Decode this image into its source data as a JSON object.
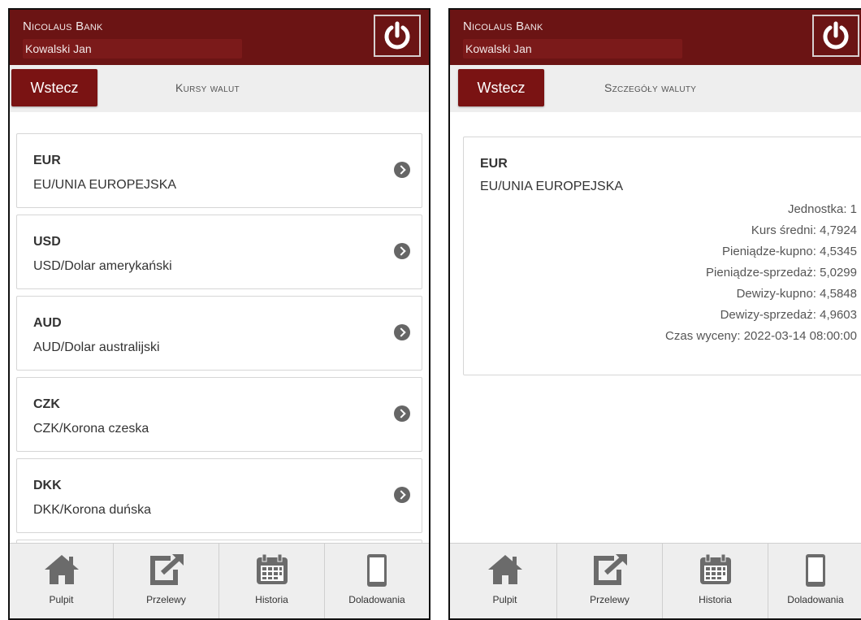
{
  "left": {
    "header": {
      "bank": "Nicolaus Bank",
      "user": "Kowalski Jan"
    },
    "back_label": "Wstecz",
    "title": "Kursy walut",
    "currencies": [
      {
        "code": "EUR",
        "name": "EU/UNIA EUROPEJSKA"
      },
      {
        "code": "USD",
        "name": "USD/Dolar amerykański"
      },
      {
        "code": "AUD",
        "name": "AUD/Dolar australijski"
      },
      {
        "code": "CZK",
        "name": "CZK/Korona czeska"
      },
      {
        "code": "DKK",
        "name": "DKK/Korona duńska"
      }
    ],
    "nav": [
      {
        "label": "Pulpit",
        "icon": "home-icon"
      },
      {
        "label": "Przelewy",
        "icon": "share-icon"
      },
      {
        "label": "Historia",
        "icon": "calendar-icon"
      },
      {
        "label": "Doladowania",
        "icon": "phone-icon"
      }
    ]
  },
  "right": {
    "header": {
      "bank": "Nicolaus Bank",
      "user": "Kowalski Jan"
    },
    "back_label": "Wstecz",
    "title": "Szczegóły waluty",
    "detail": {
      "code": "EUR",
      "name": "EU/UNIA EUROPEJSKA",
      "fields": [
        "Jednostka: 1",
        "Kurs średni: 4,7924",
        "Pieniądze-kupno: 4,5345",
        "Pieniądze-sprzedaż: 5,0299",
        "Dewizy-kupno: 4,5848",
        "Dewizy-sprzedaż: 4,9603",
        "Czas wyceny: 2022-03-14 08:00:00"
      ]
    },
    "nav": [
      {
        "label": "Pulpit",
        "icon": "home-icon"
      },
      {
        "label": "Przelewy",
        "icon": "share-icon"
      },
      {
        "label": "Historia",
        "icon": "calendar-icon"
      },
      {
        "label": "Doladowania",
        "icon": "phone-icon"
      }
    ]
  },
  "colors": {
    "brand": "#6b1414",
    "button": "#7a1313",
    "bar": "#eeeeee"
  }
}
